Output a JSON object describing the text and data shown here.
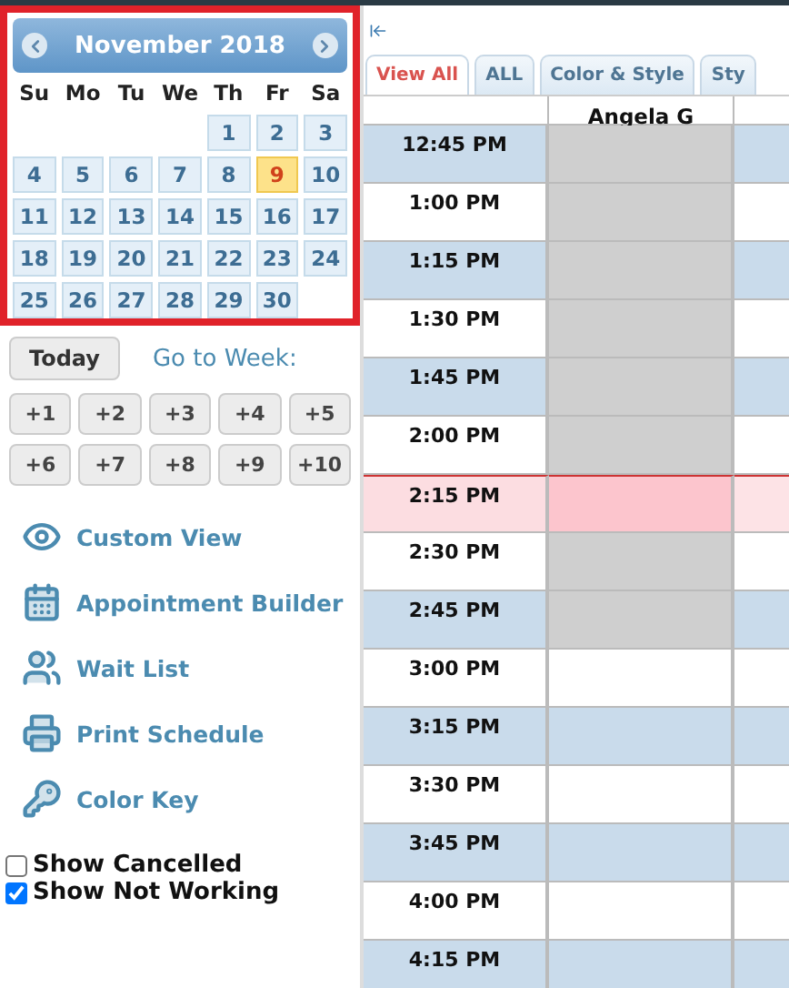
{
  "calendar": {
    "title": "November 2018",
    "weekdays": [
      "Su",
      "Mo",
      "Tu",
      "We",
      "Th",
      "Fr",
      "Sa"
    ],
    "weeks": [
      {
        "kind": "partial",
        "days": [
          {
            "day": "1",
            "selected": false
          },
          {
            "day": "2",
            "selected": false
          },
          {
            "day": "3",
            "selected": false
          }
        ]
      },
      {
        "kind": "full",
        "days": [
          {
            "day": "4",
            "selected": false
          },
          {
            "day": "5",
            "selected": false
          },
          {
            "day": "6",
            "selected": false
          },
          {
            "day": "7",
            "selected": false
          },
          {
            "day": "8",
            "selected": false
          },
          {
            "day": "9",
            "selected": true
          },
          {
            "day": "10",
            "selected": false
          }
        ]
      },
      {
        "kind": "full",
        "days": [
          {
            "day": "11",
            "selected": false
          },
          {
            "day": "12",
            "selected": false
          },
          {
            "day": "13",
            "selected": false
          },
          {
            "day": "14",
            "selected": false
          },
          {
            "day": "15",
            "selected": false
          },
          {
            "day": "16",
            "selected": false
          },
          {
            "day": "17",
            "selected": false
          }
        ]
      },
      {
        "kind": "full",
        "days": [
          {
            "day": "18",
            "selected": false
          },
          {
            "day": "19",
            "selected": false
          },
          {
            "day": "20",
            "selected": false
          },
          {
            "day": "21",
            "selected": false
          },
          {
            "day": "22",
            "selected": false
          },
          {
            "day": "23",
            "selected": false
          },
          {
            "day": "24",
            "selected": false
          }
        ]
      },
      {
        "kind": "full",
        "days": [
          {
            "day": "25",
            "selected": false
          },
          {
            "day": "26",
            "selected": false
          },
          {
            "day": "27",
            "selected": false
          },
          {
            "day": "28",
            "selected": false
          },
          {
            "day": "29",
            "selected": false
          },
          {
            "day": "30",
            "selected": false
          }
        ]
      }
    ]
  },
  "today_button": "Today",
  "go_to_week": "Go to Week:",
  "week_buttons": [
    "+1",
    "+2",
    "+3",
    "+4",
    "+5",
    "+6",
    "+7",
    "+8",
    "+9",
    "+10"
  ],
  "menu": [
    {
      "kind": "eye",
      "label": "Custom View"
    },
    {
      "kind": "calendar",
      "label": "Appointment Builder"
    },
    {
      "kind": "people",
      "label": "Wait List"
    },
    {
      "kind": "printer",
      "label": "Print Schedule"
    },
    {
      "kind": "key",
      "label": "Color Key"
    }
  ],
  "options": [
    {
      "label": "Show Cancelled",
      "checked": false
    },
    {
      "label": "Show Not Working",
      "checked": true
    }
  ],
  "tabs": [
    {
      "label": "View All",
      "selected": true
    },
    {
      "label": "ALL",
      "selected": false
    },
    {
      "label": "Color & Style",
      "selected": false
    },
    {
      "label": "Sty",
      "selected": false
    }
  ],
  "columns": [
    "Angela G"
  ],
  "rows": [
    {
      "time": "12:45 PM",
      "current": false,
      "not_working": true
    },
    {
      "time": "1:00 PM",
      "current": false,
      "not_working": true
    },
    {
      "time": "1:15 PM",
      "current": false,
      "not_working": true
    },
    {
      "time": "1:30 PM",
      "current": false,
      "not_working": true
    },
    {
      "time": "1:45 PM",
      "current": false,
      "not_working": true
    },
    {
      "time": "2:00 PM",
      "current": false,
      "not_working": true
    },
    {
      "time": "2:15 PM",
      "current": true
    },
    {
      "time": "2:30 PM",
      "current": false,
      "not_working": true
    },
    {
      "time": "2:45 PM",
      "current": false,
      "not_working": true
    },
    {
      "time": "3:00 PM",
      "current": false,
      "not_working": false
    },
    {
      "time": "3:15 PM",
      "current": false,
      "not_working": false
    },
    {
      "time": "3:30 PM",
      "current": false,
      "not_working": false
    },
    {
      "time": "3:45 PM",
      "current": false,
      "not_working": false
    },
    {
      "time": "4:00 PM",
      "current": false,
      "not_working": false
    },
    {
      "time": "4:15 PM",
      "current": false,
      "not_working": false
    }
  ]
}
